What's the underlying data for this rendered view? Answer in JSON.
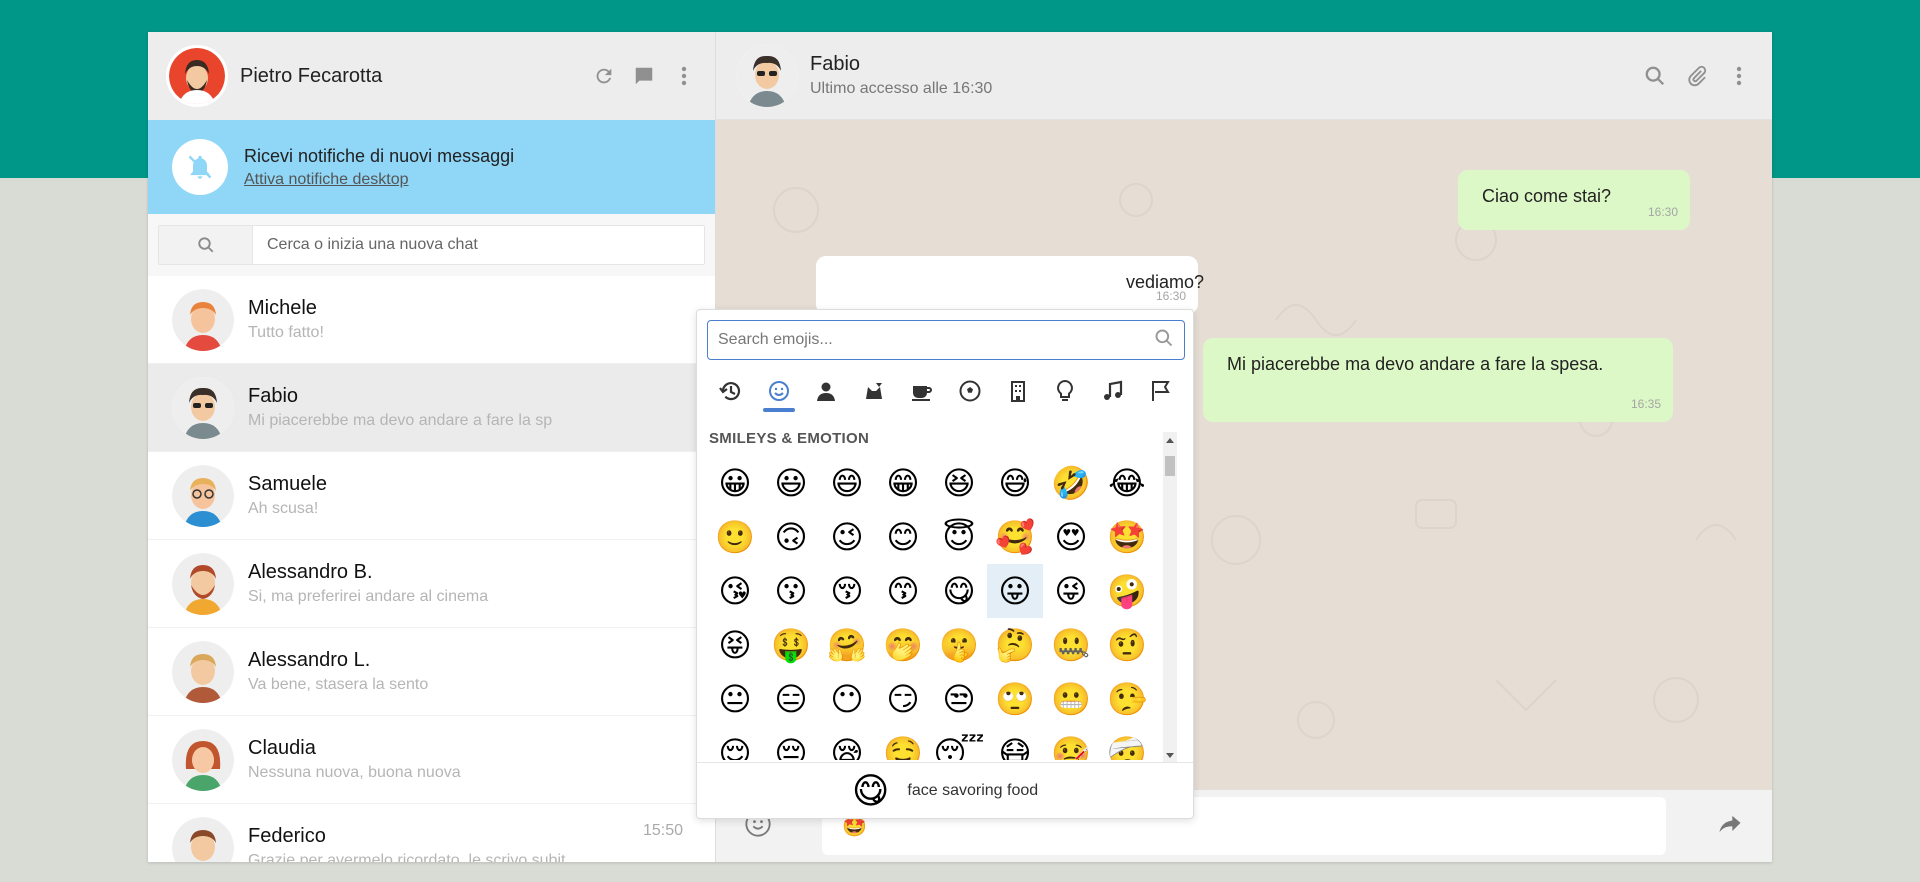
{
  "me": {
    "name": "Pietro Fecarotta"
  },
  "notification": {
    "title": "Ricevi notifiche di nuovi messaggi",
    "link": "Attiva notifiche desktop"
  },
  "search": {
    "placeholder": "Cerca o inizia una nuova chat"
  },
  "chats": [
    {
      "name": "Michele",
      "last": "Tutto fatto!",
      "time": ""
    },
    {
      "name": "Fabio",
      "last": "Mi piacerebbe ma devo andare a fare la sp",
      "time": "",
      "active": true
    },
    {
      "name": "Samuele",
      "last": "Ah scusa!",
      "time": ""
    },
    {
      "name": "Alessandro B.",
      "last": "Si, ma preferirei andare al cinema",
      "time": ""
    },
    {
      "name": "Alessandro L.",
      "last": "Va bene, stasera la sento",
      "time": ""
    },
    {
      "name": "Claudia",
      "last": "Nessuna nuova, buona nuova",
      "time": ""
    },
    {
      "name": "Federico",
      "last": "Grazie per avermelo ricordato, le scrivo subit…",
      "time": "15:50"
    }
  ],
  "contact": {
    "name": "Fabio",
    "status": "Ultimo accesso alle 16:30"
  },
  "messages": [
    {
      "type": "sent",
      "text": "Ciao come stai?",
      "time": "16:30"
    },
    {
      "type": "recv",
      "text": "vediamo?",
      "time": "16:30"
    },
    {
      "type": "sent",
      "text": "Mi piacerebbe ma devo andare a fare la spesa.",
      "time": "16:35"
    }
  ],
  "composer": {
    "value": "🤩"
  },
  "emoji_picker": {
    "search_placeholder": "Search emojis...",
    "category_title": "SMILEYS & EMOTION",
    "categories": [
      "recent-icon",
      "smiley-icon",
      "person-icon",
      "animal-icon",
      "food-icon",
      "activity-icon",
      "building-icon",
      "lightbulb-icon",
      "music-icon",
      "flag-icon"
    ],
    "active_category": 1,
    "emojis": [
      "😀",
      "😃",
      "😄",
      "😁",
      "😆",
      "😅",
      "🤣",
      "😂",
      "🙂",
      "🙃",
      "😉",
      "😊",
      "😇",
      "🥰",
      "😍",
      "🤩",
      "😘",
      "😗",
      "😚",
      "😙",
      "😋",
      "😛",
      "😜",
      "🤪",
      "😝",
      "🤑",
      "🤗",
      "🤭",
      "🤫",
      "🤔",
      "🤐",
      "🤨",
      "😐",
      "😑",
      "😶",
      "😏",
      "😒",
      "🙄",
      "😬",
      "🤥",
      "😌",
      "😔",
      "😪",
      "🤤",
      "😴",
      "😷",
      "🤒",
      "🤕"
    ],
    "highlighted_index": 21,
    "preview_emoji": "😋",
    "preview_name": "face savoring food"
  }
}
